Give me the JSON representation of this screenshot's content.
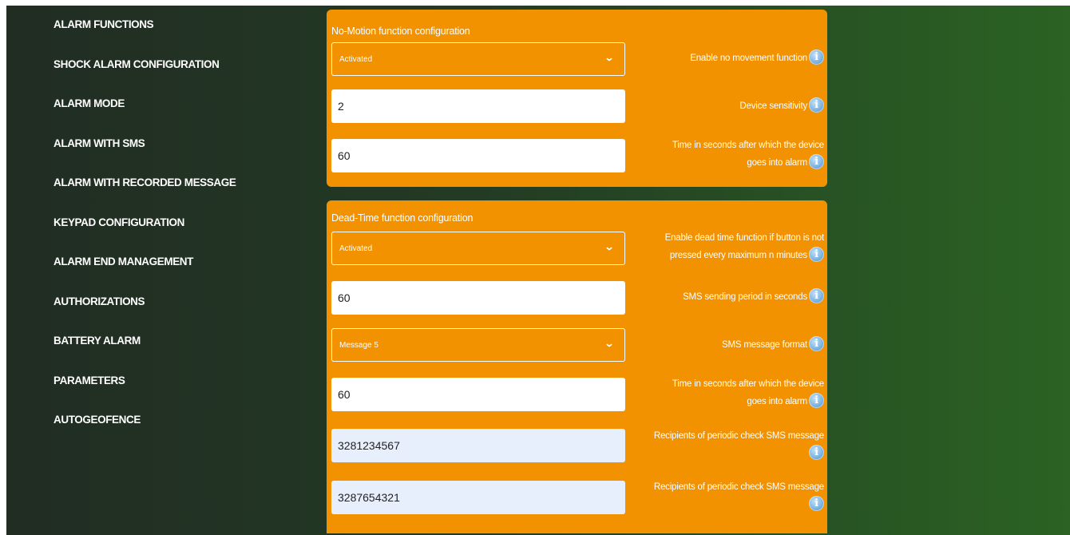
{
  "sidebar": {
    "items": [
      {
        "label": "ALARM FUNCTIONS"
      },
      {
        "label": "SHOCK ALARM CONFIGURATION"
      },
      {
        "label": "ALARM MODE"
      },
      {
        "label": "ALARM WITH SMS"
      },
      {
        "label": "ALARM WITH RECORDED MESSAGE"
      },
      {
        "label": "KEYPAD CONFIGURATION"
      },
      {
        "label": "ALARM END MANAGEMENT"
      },
      {
        "label": "AUTHORIZATIONS"
      },
      {
        "label": "BATTERY ALARM"
      },
      {
        "label": "PARAMETERS"
      },
      {
        "label": "AUTOGEOFENCE"
      }
    ]
  },
  "no_motion": {
    "title": "No-Motion function configuration",
    "enable_select": {
      "value": "Activated",
      "label": "Enable no movement function"
    },
    "sensitivity": {
      "value": "2",
      "label": "Device sensitivity"
    },
    "alarm_time": {
      "value": "60",
      "label_line1": "Time in seconds after which the device",
      "label_line2": "goes into alarm"
    }
  },
  "dead_time": {
    "title": "Dead-Time function configuration",
    "enable_select": {
      "value": "Activated",
      "label_line1": "Enable dead time function if button is not",
      "label_line2": "pressed every maximum n minutes"
    },
    "sms_period": {
      "value": "60",
      "label": "SMS sending period in seconds"
    },
    "sms_format": {
      "value": "Message 5",
      "label": "SMS message format"
    },
    "alarm_time": {
      "value": "60",
      "label_line1": "Time in seconds after which the device",
      "label_line2": "goes into alarm"
    },
    "recipient_1": {
      "value": "3281234567",
      "label": "Recipients of periodic check SMS message"
    },
    "recipient_2": {
      "value": "3287654321",
      "label": "Recipients of periodic check SMS message"
    }
  },
  "icons": {
    "info_icon": "info-icon",
    "chevron": "chevron-down-icon"
  },
  "colors": {
    "panel": "#f39200",
    "recipient_field": "#e8effc",
    "info_icon": "#7db4e2"
  }
}
